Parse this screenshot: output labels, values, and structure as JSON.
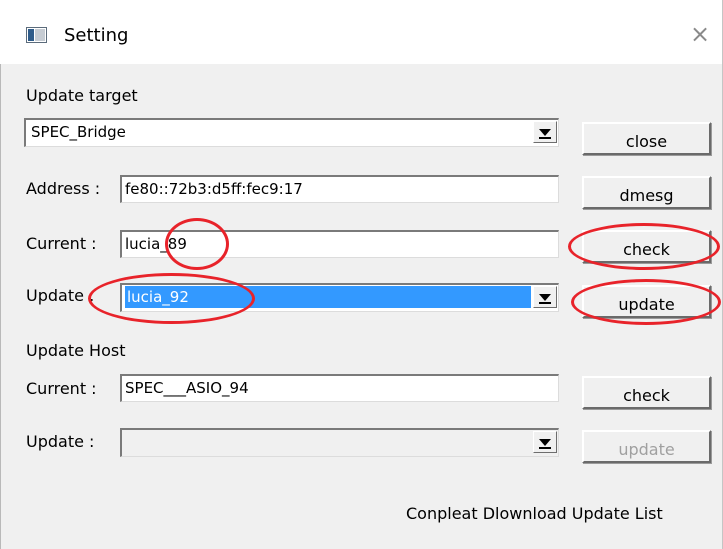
{
  "window": {
    "title": "Setting",
    "close_glyph": "×",
    "icon": "app-window-icon"
  },
  "update_target": {
    "heading": "Update target",
    "target_combo_value": "SPEC_Bridge",
    "close_label": "close",
    "address_label": "Address :",
    "address_value": "fe80::72b3:d5ff:fec9:17",
    "dmesg_label": "dmesg",
    "current_label": "Current :",
    "current_value": "lucia_89",
    "check_label": "check",
    "update_label": "Update :",
    "update_value": "lucia_92",
    "update_button_label": "update"
  },
  "update_host": {
    "heading": "Update Host",
    "current_label": "Current :",
    "current_value": "SPEC___ASIO_94",
    "check_label": "check",
    "update_label": "Update :",
    "update_value": "",
    "update_button_label": "update"
  },
  "status": {
    "message": "Conpleat Dlownload Update List"
  },
  "colors": {
    "annotation": "#e8232a",
    "selection": "#3399ff",
    "dialog_bg": "#f0f0f0"
  }
}
